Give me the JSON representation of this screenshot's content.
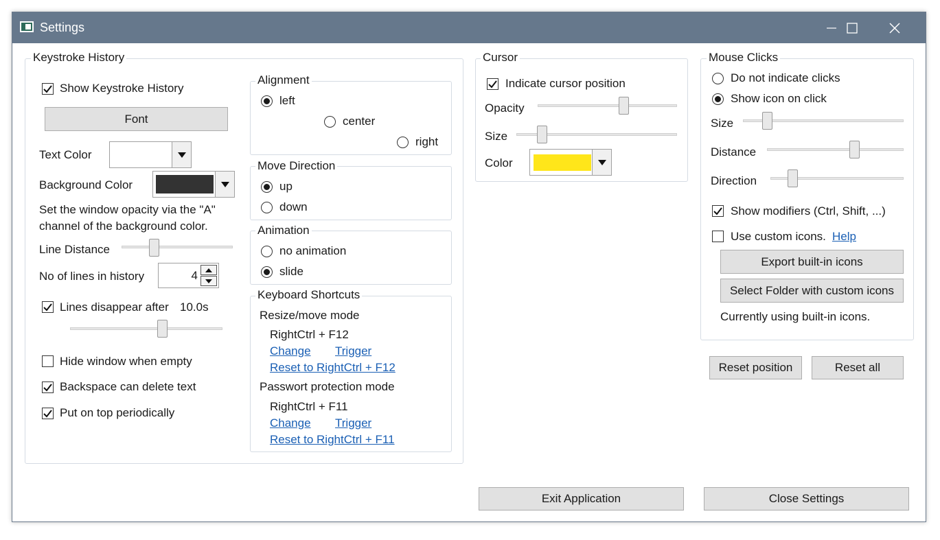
{
  "window": {
    "title": "Settings",
    "controls": [
      "minimize",
      "maximize",
      "close"
    ]
  },
  "keystroke": {
    "legend": "Keystroke History",
    "show_history_label": "Show Keystroke History",
    "show_history_checked": true,
    "font_button": "Font",
    "text_color_label": "Text Color",
    "text_color_value": "#ffffff",
    "background_color_label": "Background Color",
    "background_color_value": "#333333",
    "opacity_note_1": "Set the window opacity via the \"A\"",
    "opacity_note_2": "channel of the background color.",
    "line_distance_label": "Line Distance",
    "line_distance_level": 0.3,
    "lines_label": "No of lines in history",
    "lines_value": "4",
    "disappear_label": "Lines disappear after",
    "disappear_value": "10.0s",
    "disappear_checked": true,
    "disappear_level": 0.6,
    "hide_window_label": "Hide window when empty",
    "hide_window_checked": false,
    "backspace_label": "Backspace can delete text",
    "backspace_checked": true,
    "on_top_label": "Put on top periodically",
    "on_top_checked": true
  },
  "alignment": {
    "legend": "Alignment",
    "options": [
      "left",
      "center",
      "right"
    ],
    "selected": "left"
  },
  "move_direction": {
    "legend": "Move Direction",
    "options": [
      "up",
      "down"
    ],
    "selected": "up"
  },
  "animation": {
    "legend": "Animation",
    "options": [
      "no animation",
      "slide"
    ],
    "selected": "slide"
  },
  "shortcuts": {
    "legend": "Keyboard Shortcuts",
    "resize_title": "Resize/move mode",
    "resize_key": "RightCtrl + F12",
    "resize_change": "Change",
    "resize_trigger": "Trigger",
    "resize_reset": "Reset to RightCtrl + F12",
    "password_title": "Passwort protection mode",
    "password_key": "RightCtrl + F11",
    "password_change": "Change",
    "password_trigger": "Trigger",
    "password_reset": "Reset to RightCtrl + F11"
  },
  "cursor": {
    "legend": "Cursor",
    "indicate_label": "Indicate cursor position",
    "indicate_checked": true,
    "opacity_label": "Opacity",
    "opacity_level": 0.6,
    "size_label": "Size",
    "size_level": 0.12,
    "color_label": "Color",
    "color_value": "#ffe61a"
  },
  "mouse": {
    "legend": "Mouse Clicks",
    "options": [
      "Do not indicate clicks",
      "Show icon on click"
    ],
    "selected": "Show icon on click",
    "size_label": "Size",
    "size_level": 0.15,
    "distance_label": "Distance",
    "distance_level": 0.62,
    "direction_label": "Direction",
    "direction_level": 0.15,
    "modifiers_label": "Show modifiers (Ctrl, Shift, ...)",
    "modifiers_checked": true,
    "custom_icons_label": "Use custom icons.",
    "custom_icons_checked": false,
    "help_link": "Help",
    "export_button": "Export built-in icons",
    "select_folder_button": "Select Folder with custom icons",
    "status": "Currently using built-in icons."
  },
  "buttons": {
    "reset_position": "Reset position",
    "reset_all": "Reset all",
    "exit": "Exit Application",
    "close": "Close Settings"
  }
}
